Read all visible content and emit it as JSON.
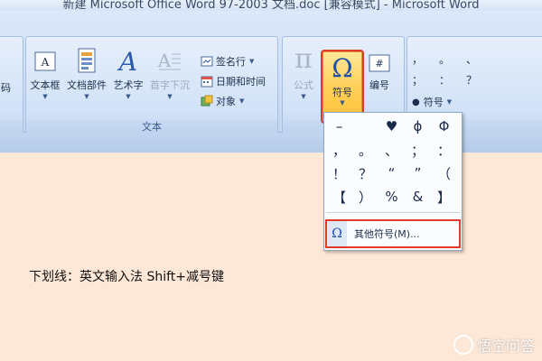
{
  "window": {
    "title": "新建 Microsoft Office Word 97-2003 文档.doc [兼容模式] - Microsoft Word"
  },
  "ribbon": {
    "partial_left_label": "码",
    "text_group": {
      "label": "文本",
      "textbox": "文本框",
      "quickparts": "文档部件",
      "wordart": "艺术字",
      "dropcap": "首字下沉",
      "signature": "签名行",
      "datetime": "日期和时间",
      "object": "对象"
    },
    "symbols_group": {
      "equation": "公式",
      "symbol": "符号",
      "number": "编号"
    },
    "special_panel": {
      "row1": [
        "，",
        "。",
        "、"
      ],
      "row2": [
        "；",
        "：",
        "？"
      ],
      "special_label": "符号"
    }
  },
  "symbol_dropdown": {
    "grid": [
      "–",
      "",
      "♥",
      "ϕ",
      "Φ",
      "，",
      "。",
      "、",
      "；",
      "：",
      "！",
      "？",
      "“",
      "”",
      "（",
      "【",
      "）",
      "%",
      "&",
      "】"
    ],
    "more_symbols": "其他符号(M)..."
  },
  "document": {
    "body_text": "下划线：英文输入法 Shift+减号键"
  },
  "watermark": {
    "text": "悟空问答"
  }
}
